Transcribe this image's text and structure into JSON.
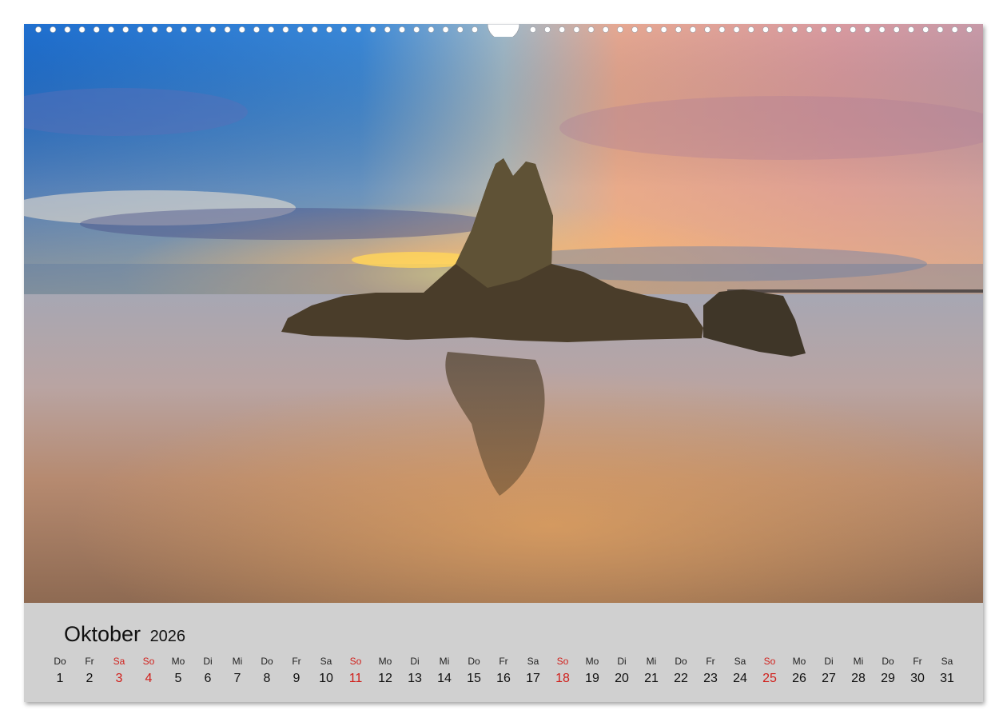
{
  "calendar": {
    "month": "Oktober",
    "year": "2026",
    "days": [
      {
        "wd": "Do",
        "d": "1"
      },
      {
        "wd": "Fr",
        "d": "2"
      },
      {
        "wd": "Sa",
        "d": "3",
        "weekend": true
      },
      {
        "wd": "So",
        "d": "4",
        "weekend": true
      },
      {
        "wd": "Mo",
        "d": "5"
      },
      {
        "wd": "Di",
        "d": "6"
      },
      {
        "wd": "Mi",
        "d": "7"
      },
      {
        "wd": "Do",
        "d": "8"
      },
      {
        "wd": "Fr",
        "d": "9"
      },
      {
        "wd": "Sa",
        "d": "10"
      },
      {
        "wd": "So",
        "d": "11",
        "weekend": true
      },
      {
        "wd": "Mo",
        "d": "12"
      },
      {
        "wd": "Di",
        "d": "13"
      },
      {
        "wd": "Mi",
        "d": "14"
      },
      {
        "wd": "Do",
        "d": "15"
      },
      {
        "wd": "Fr",
        "d": "16"
      },
      {
        "wd": "Sa",
        "d": "17"
      },
      {
        "wd": "So",
        "d": "18",
        "weekend": true
      },
      {
        "wd": "Mo",
        "d": "19"
      },
      {
        "wd": "Di",
        "d": "20"
      },
      {
        "wd": "Mi",
        "d": "21"
      },
      {
        "wd": "Do",
        "d": "22"
      },
      {
        "wd": "Fr",
        "d": "23"
      },
      {
        "wd": "Sa",
        "d": "24"
      },
      {
        "wd": "So",
        "d": "25",
        "weekend": true
      },
      {
        "wd": "Mo",
        "d": "26"
      },
      {
        "wd": "Di",
        "d": "27"
      },
      {
        "wd": "Mi",
        "d": "28"
      },
      {
        "wd": "Do",
        "d": "29"
      },
      {
        "wd": "Fr",
        "d": "30"
      },
      {
        "wd": "Sa",
        "d": "31"
      }
    ]
  },
  "colors": {
    "weekend": "#d0201c",
    "footer_bg": "#d0d0d0"
  }
}
